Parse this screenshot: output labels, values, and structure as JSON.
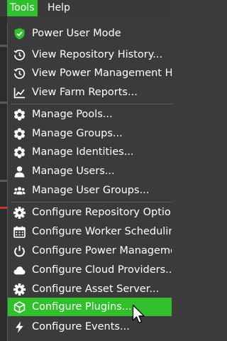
{
  "menubar": {
    "items": [
      {
        "label": "Tools",
        "active": true
      },
      {
        "label": "Help",
        "active": false
      }
    ]
  },
  "menu": {
    "items": [
      {
        "label": "Power User Mode",
        "icon": "shield-icon"
      },
      {
        "label": "View Repository History...",
        "icon": "history-clock-icon"
      },
      {
        "label": "View Power Management Hi",
        "icon": "history-clock-icon"
      },
      {
        "label": "View Farm Reports...",
        "icon": "line-chart-icon"
      },
      {
        "label": "Manage Pools...",
        "icon": "flower-icon"
      },
      {
        "label": "Manage Groups...",
        "icon": "flower-icon"
      },
      {
        "label": "Manage Identities...",
        "icon": "flower-icon"
      },
      {
        "label": "Manage Users...",
        "icon": "user-icon"
      },
      {
        "label": "Manage User Groups...",
        "icon": "users-icon"
      },
      {
        "label": "Configure Repository Optior",
        "icon": "gear-icon"
      },
      {
        "label": "Configure Worker Schedulin",
        "icon": "calendar-icon"
      },
      {
        "label": "Configure Power Manageme",
        "icon": "power-icon"
      },
      {
        "label": "Configure Cloud Providers...",
        "icon": "cloud-icon"
      },
      {
        "label": "Configure Asset Server...",
        "icon": "gear-icon"
      },
      {
        "label": "Configure Plugins...",
        "icon": "cube-icon",
        "highlighted": true
      },
      {
        "label": "Configure Events...",
        "icon": "bolt-icon"
      }
    ]
  },
  "colors": {
    "highlight": "#2fc02c",
    "menu_bg": "#3b3b3b",
    "text": "#ffffff",
    "shield_green": "#33c22f"
  }
}
